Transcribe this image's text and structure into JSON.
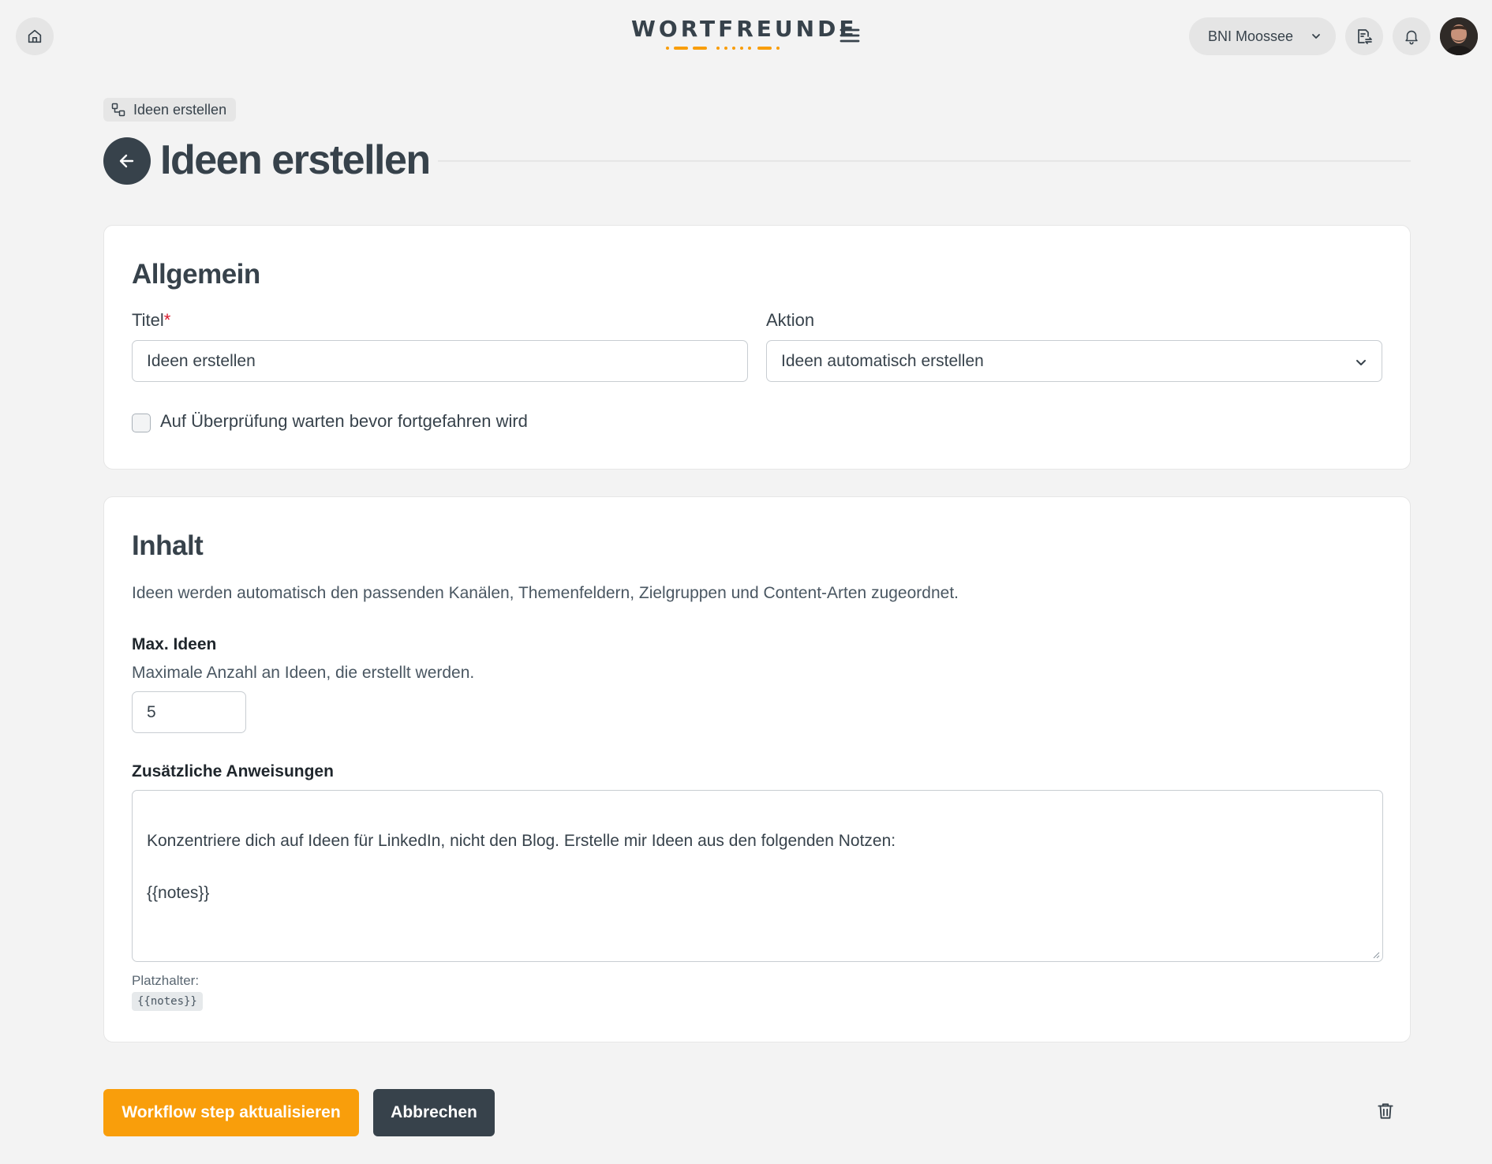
{
  "app": {
    "logo_text": "WORTFREUNDE",
    "accent_color": "#f99e0b",
    "dark_color": "#37424b"
  },
  "topbar": {
    "home_icon": "home-icon",
    "menu_icon": "hamburger-menu-icon",
    "organization": "BNI Moossee",
    "doc_icon": "document-swap-icon",
    "bell_icon": "bell-icon",
    "avatar_icon": "user-avatar"
  },
  "header": {
    "breadcrumb_icon": "workflow-icon",
    "breadcrumb": "Ideen erstellen",
    "title": "Ideen erstellen"
  },
  "general": {
    "heading": "Allgemein",
    "title_label": "Titel",
    "title_required_mark": "*",
    "title_value": "Ideen erstellen",
    "action_label": "Aktion",
    "action_value": "Ideen automatisch erstellen",
    "wait_review_label": "Auf Überprüfung warten bevor fortgefahren wird",
    "wait_review_checked": false
  },
  "content": {
    "heading": "Inhalt",
    "description": "Ideen werden automatisch den passenden Kanälen, Themenfeldern, Zielgruppen und Content-Arten zugeordnet.",
    "max_ideas_label": "Max. Ideen",
    "max_ideas_hint": "Maximale Anzahl an Ideen, die erstellt werden.",
    "max_ideas_value": "5",
    "instructions_label": "Zusätzliche Anweisungen",
    "instructions_value": "Konzentriere dich auf Ideen für LinkedIn, nicht den Blog. Erstelle mir Ideen aus den folgenden Notzen:\n\n{{notes}}",
    "placeholders_label": "Platzhalter:",
    "placeholder_chip": "{{notes}}"
  },
  "footer": {
    "submit_label": "Workflow step aktualisieren",
    "cancel_label": "Abbrechen",
    "delete_icon": "trash-icon"
  }
}
